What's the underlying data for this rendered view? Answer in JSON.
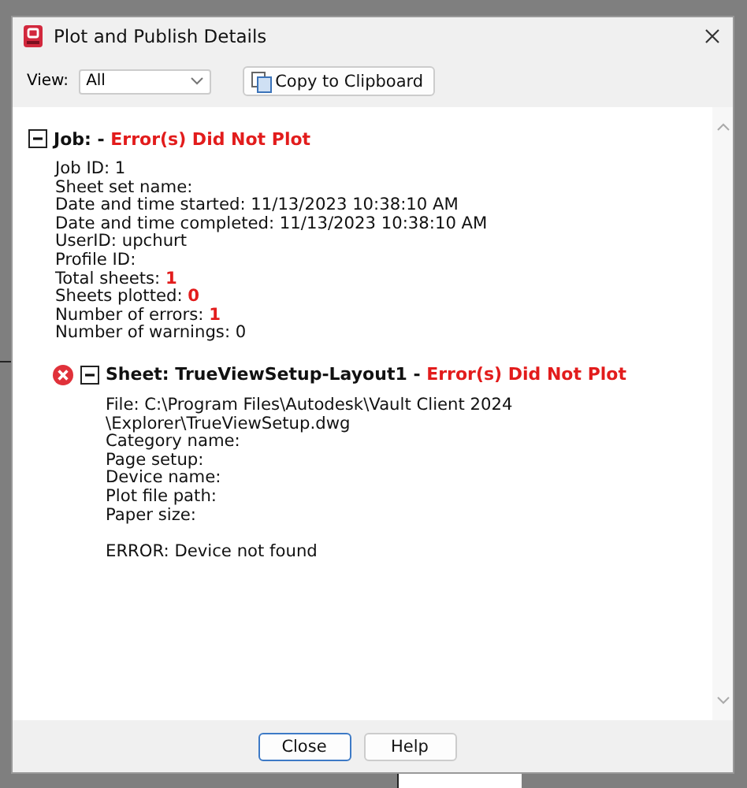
{
  "window": {
    "title": "Plot and Publish Details"
  },
  "toolbar": {
    "view_label": "View:",
    "view_value": "All",
    "copy_button": "Copy to Clipboard"
  },
  "job": {
    "expanded": true,
    "heading": "Job:",
    "separator": "-",
    "status": "Error(s) Did Not Plot",
    "lines": [
      {
        "text": "Job ID: 1"
      },
      {
        "text": "Sheet set name:"
      },
      {
        "text": "Date and time started: 11/13/2023 10:38:10 AM"
      },
      {
        "text": "Date and time completed: 11/13/2023 10:38:10 AM"
      },
      {
        "text": "UserID: upchurt"
      },
      {
        "text": "Profile ID:"
      },
      {
        "text": "Total sheets:",
        "value": "1",
        "alert": true
      },
      {
        "text": "Sheets plotted:",
        "value": "0",
        "alert": true
      },
      {
        "text": "Number of errors:",
        "value": "1",
        "alert": true
      },
      {
        "text": "Number of warnings: 0"
      }
    ]
  },
  "sheets": [
    {
      "expanded": true,
      "failed": true,
      "heading": "Sheet: TrueViewSetup-Layout1",
      "separator": "-",
      "status": "Error(s) Did Not Plot",
      "lines": [
        {
          "text": "File: C:\\Program Files\\Autodesk\\Vault Client 2024"
        },
        {
          "text": "\\Explorer\\TrueViewSetup.dwg"
        },
        {
          "text": "Category name:"
        },
        {
          "text": "Page setup:"
        },
        {
          "text": "Device name:"
        },
        {
          "text": "Plot file path:"
        },
        {
          "text": "Paper size:"
        }
      ],
      "error": "ERROR: Device not found"
    }
  ],
  "buttons": [
    {
      "label": "Close",
      "focused": true
    },
    {
      "label": "Help",
      "focused": false
    }
  ]
}
